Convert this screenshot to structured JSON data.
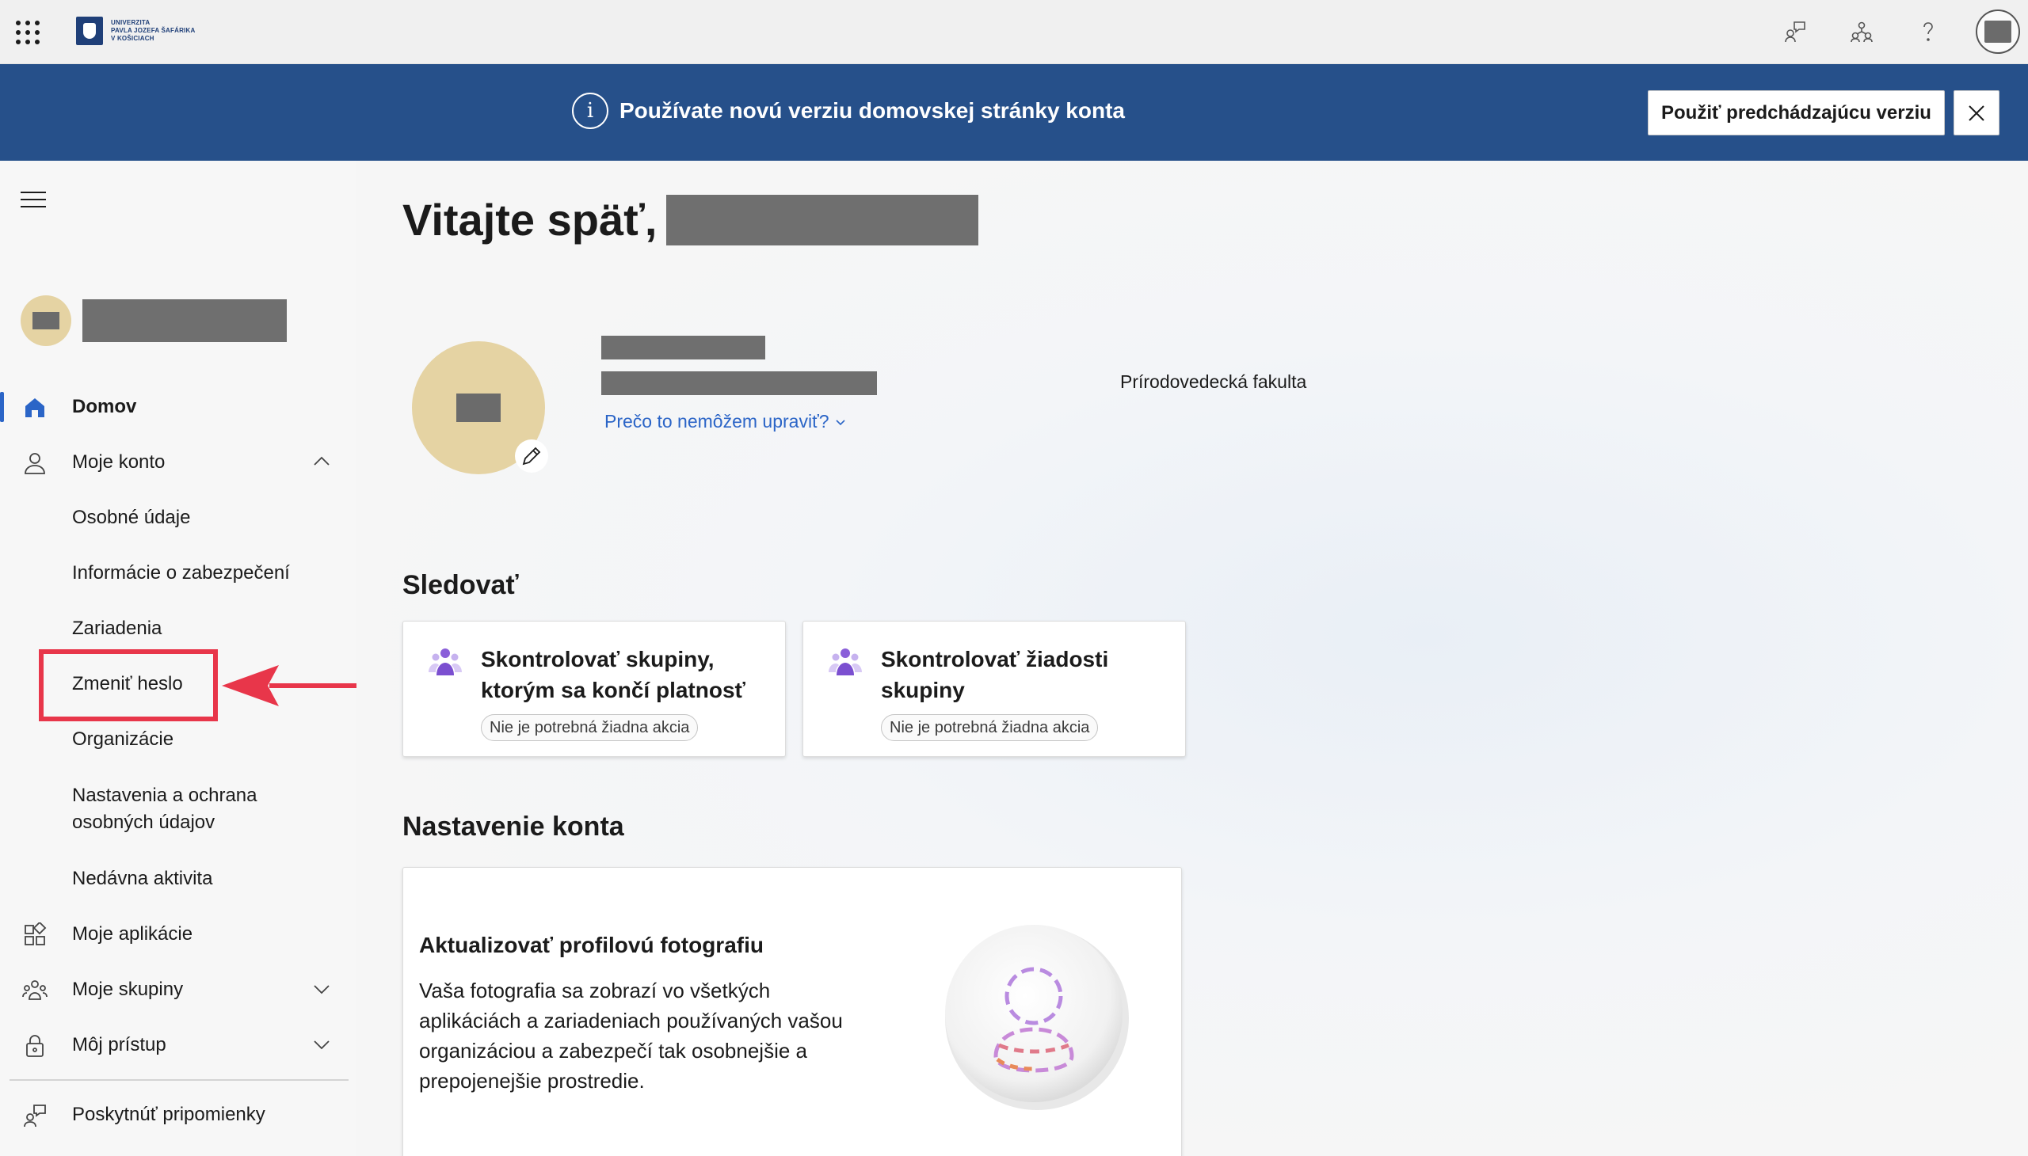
{
  "topbar": {
    "logo_lines": [
      "UNIVERZITA",
      "PAVLA JOZEFA ŠAFÁRIKA",
      "V KOŠICIACH"
    ],
    "icons": [
      "feedback-icon",
      "organization-icon",
      "help-icon",
      "account-avatar"
    ]
  },
  "banner": {
    "message": "Používate novú verziu domovskej stránky konta",
    "previous_version_button": "Použiť predchádzajúcu verziu",
    "bg_color": "#26508a"
  },
  "sidebar": {
    "items": [
      {
        "label": "Domov",
        "icon": "home-icon",
        "active": true
      },
      {
        "label": "Moje konto",
        "icon": "person-icon",
        "expanded": true
      },
      {
        "label": "Osobné údaje"
      },
      {
        "label": "Informácie o zabezpečení"
      },
      {
        "label": "Zariadenia"
      },
      {
        "label": "Zmeniť heslo",
        "highlighted": true
      },
      {
        "label": "Organizácie"
      },
      {
        "label": "Nastavenia a ochrana osobných údajov"
      },
      {
        "label": "Nedávna aktivita"
      },
      {
        "label": "Moje aplikácie",
        "icon": "apps-icon"
      },
      {
        "label": "Moje skupiny",
        "icon": "groups-icon",
        "expanded": false
      },
      {
        "label": "Môj prístup",
        "icon": "access-icon",
        "expanded": false
      },
      {
        "label": "Poskytnúť pripomienky",
        "icon": "feedback-icon"
      }
    ]
  },
  "main": {
    "welcome": "Vitajte späť,",
    "why_cant_edit": "Prečo to nemôžem upraviť?",
    "faculty": "Prírodovedecká fakulta",
    "follow_title": "Sledovať",
    "follow_cards": [
      {
        "title": "Skontrolovať skupiny, ktorým sa končí platnosť",
        "status": "Nie je potrebná žiadna akcia"
      },
      {
        "title": "Skontrolovať žiadosti skupiny",
        "status": "Nie je potrebná žiadna akcia"
      }
    ],
    "account_settings_title": "Nastavenie konta",
    "account_card": {
      "title": "Aktualizovať profilovú fotografiu",
      "description": "Vaša fotografia sa zobrazí vo všetkých aplikáciách a zariadeniach používaných vašou organizáciou a zabezpečí tak osobnejšie a prepojenejšie prostredie."
    }
  },
  "colors": {
    "accent": "#2b65c7",
    "highlight": "#e8364a",
    "avatar_bg": "#e5d3a3"
  }
}
